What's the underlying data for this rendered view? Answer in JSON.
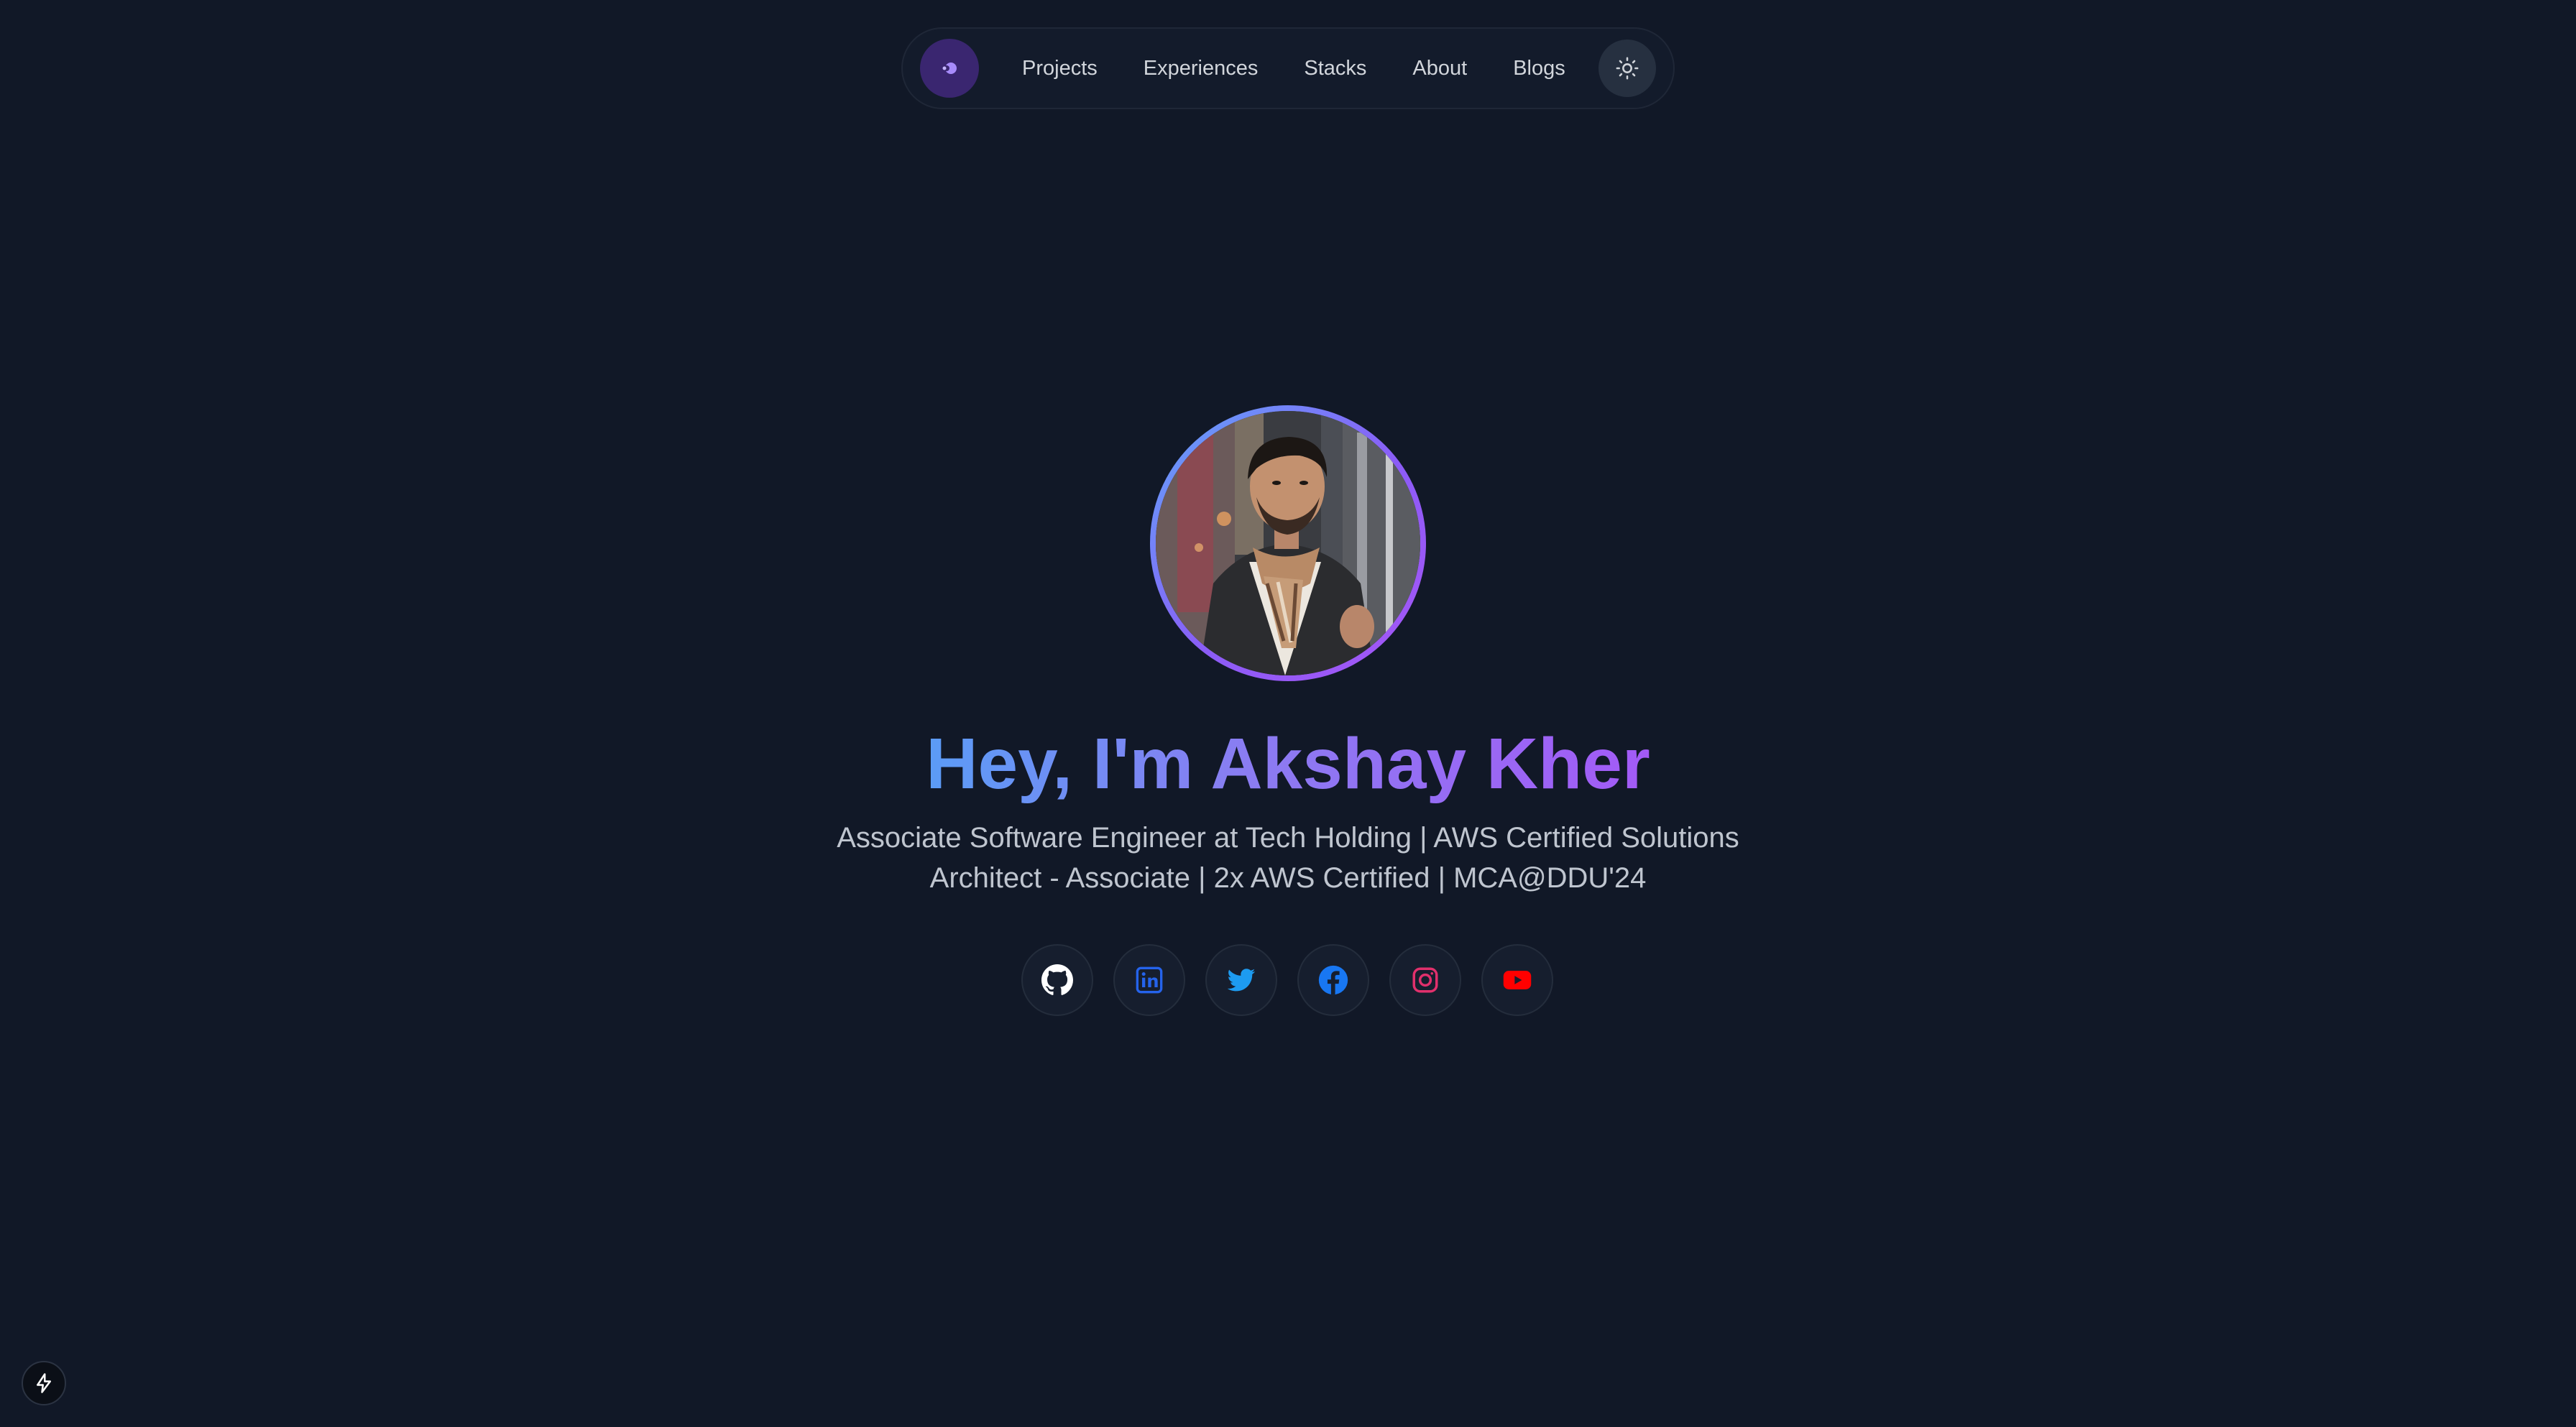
{
  "nav": {
    "logo_icon": "logo-icon",
    "links": [
      {
        "label": "Projects"
      },
      {
        "label": "Experiences"
      },
      {
        "label": "Stacks"
      },
      {
        "label": "About"
      },
      {
        "label": "Blogs"
      }
    ],
    "theme_icon": "sun-icon"
  },
  "hero": {
    "title": "Hey, I'm Akshay Kher",
    "subtitle_line1": "Associate Software Engineer at Tech Holding | AWS Certified Solutions",
    "subtitle_line2": "Architect - Associate | 2x AWS Certified | MCA@DDU'24"
  },
  "socials": [
    {
      "icon": "github-icon",
      "color": "#ffffff"
    },
    {
      "icon": "linkedin-icon",
      "color": "#2563eb"
    },
    {
      "icon": "twitter-icon",
      "color": "#1d9bf0"
    },
    {
      "icon": "facebook-icon",
      "color": "#1877f2"
    },
    {
      "icon": "instagram-icon",
      "color": "#e1306c"
    },
    {
      "icon": "youtube-icon",
      "color": "#ff0000"
    }
  ],
  "colors": {
    "background": "#111827",
    "gradient_start": "#5b9cf6",
    "gradient_end": "#a35af6",
    "nav_logo_bg": "#3a2670"
  },
  "corner_badge_icon": "lightning-icon"
}
